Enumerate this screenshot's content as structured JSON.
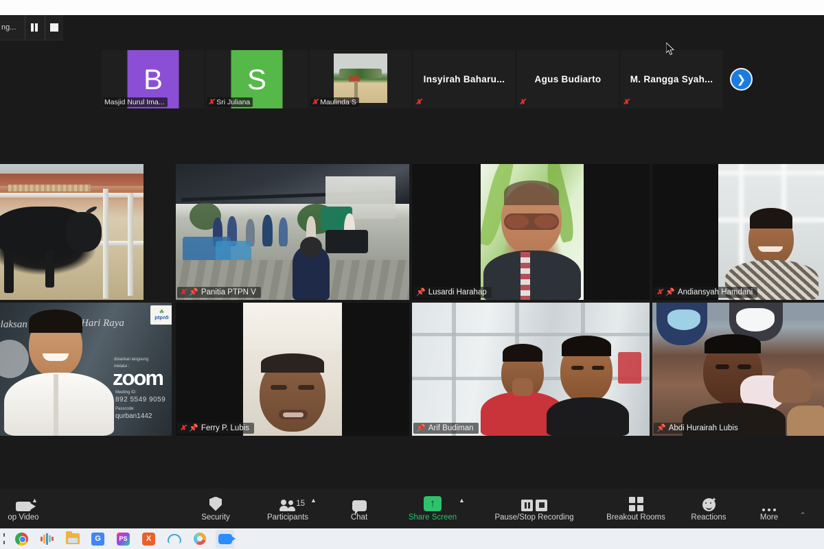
{
  "app": {
    "name": "Zoom Meeting",
    "window_title": "Zoom"
  },
  "recording_bar": {
    "label": "ng...",
    "pause_button": "Pause recording",
    "stop_button": "Stop recording"
  },
  "filmstrip": {
    "next_page_icon": "chevron-right-icon",
    "participants": [
      {
        "name": "Masjid Nurul Ima...",
        "avatar_initial": "B",
        "avatar_color": "#8b4fd6",
        "type": "avatar",
        "muted": false
      },
      {
        "name": "Sri Juliana",
        "avatar_initial": "S",
        "avatar_color": "#55b848",
        "type": "avatar",
        "muted": true
      },
      {
        "name": "Maulinda S",
        "type": "video",
        "muted": true
      },
      {
        "name": "Insyirah  Baharu...",
        "type": "name-only",
        "muted": true
      },
      {
        "name": "Agus Budiarto",
        "type": "name-only",
        "muted": true
      },
      {
        "name": "M. Rangga  Syah...",
        "type": "name-only",
        "muted": true
      }
    ]
  },
  "grid": {
    "tiles": [
      {
        "name": "",
        "scene": "cow",
        "muted": false,
        "pinned": false,
        "active": false,
        "label_visible": false
      },
      {
        "name": "Panitia PTPN V",
        "scene": "market",
        "muted": true,
        "pinned": true,
        "active": false,
        "label_visible": true
      },
      {
        "name": "Lusardi Harahap",
        "scene": "green",
        "muted": false,
        "pinned": true,
        "active": true,
        "label_visible": true
      },
      {
        "name": "Andiansyah Hamdani",
        "scene": "window",
        "muted": true,
        "pinned": true,
        "active": false,
        "label_visible": true
      },
      {
        "name": "",
        "scene": "virtual-bg",
        "muted": false,
        "pinned": false,
        "active": false,
        "label_visible": false
      },
      {
        "name": "Ferry P. Lubis",
        "scene": "wall",
        "muted": true,
        "pinned": true,
        "active": false,
        "label_visible": true
      },
      {
        "name": "Arif Budiman",
        "scene": "glass",
        "muted": false,
        "pinned": true,
        "active": false,
        "label_visible": true
      },
      {
        "name": "Abdi Hurairah Lubis",
        "scene": "crowd",
        "muted": false,
        "pinned": true,
        "active": false,
        "label_visible": true
      }
    ],
    "virtual_background": {
      "heading_left": "elaksan",
      "heading_right": "Hari Raya",
      "sub_line_1": "disiarkan langsung",
      "sub_line_2": "melalui :",
      "brand": "zoom",
      "meeting_id_label": "Meeting ID:",
      "meeting_id": "892 5549 9059",
      "passcode_label": "Passcode:",
      "passcode": "qurban1442",
      "logo_top": "☘",
      "logo_text": "ptpn5"
    }
  },
  "toolbar": {
    "items": [
      {
        "label": "op Video",
        "icon": "camera-icon",
        "caret": true,
        "accent": false
      },
      {
        "label": "Security",
        "icon": "shield-icon",
        "caret": false,
        "accent": false
      },
      {
        "label": "Participants",
        "icon": "participants-icon",
        "caret": true,
        "accent": false,
        "count": "15"
      },
      {
        "label": "Chat",
        "icon": "chat-bubble-icon",
        "caret": false,
        "accent": false
      },
      {
        "label": "Share Screen",
        "icon": "share-screen-icon",
        "caret": true,
        "accent": true
      },
      {
        "label": "Pause/Stop Recording",
        "icon": "pause-stop-recording-icon",
        "caret": false,
        "accent": false
      },
      {
        "label": "Breakout Rooms",
        "icon": "breakout-rooms-icon",
        "caret": false,
        "accent": false
      },
      {
        "label": "Reactions",
        "icon": "reactions-smiley-icon",
        "caret": false,
        "accent": false
      },
      {
        "label": "More",
        "icon": "more-ellipsis-icon",
        "caret": false,
        "accent": false
      }
    ]
  },
  "taskbar": {
    "items": [
      {
        "name": "google-chrome",
        "icon": "chrome-icon"
      },
      {
        "name": "audio-waveform-app",
        "icon": "waveform-icon"
      },
      {
        "name": "file-explorer",
        "icon": "folder-icon"
      },
      {
        "name": "google-translate",
        "icon": "google-translate-icon",
        "glyph": "G"
      },
      {
        "name": "phpstorm",
        "icon": "phpstorm-icon",
        "glyph": "PS"
      },
      {
        "name": "xmind",
        "icon": "xmind-icon",
        "glyph": "X"
      },
      {
        "name": "cloud-app",
        "icon": "cloud-icon"
      },
      {
        "name": "color-ring-app",
        "icon": "ring-icon"
      },
      {
        "name": "zoom",
        "icon": "zoom-icon",
        "active": true
      }
    ]
  }
}
